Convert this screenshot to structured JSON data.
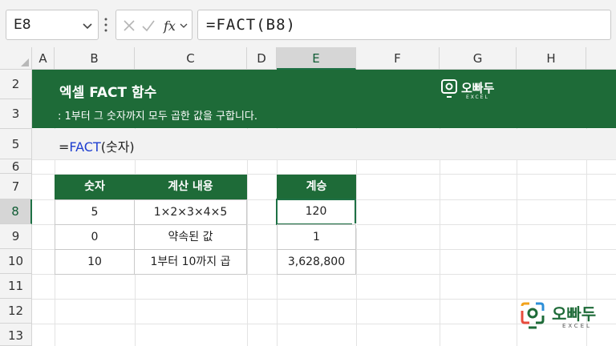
{
  "formula_bar": {
    "name_box": "E8",
    "formula": "=FACT(B8)",
    "icons": [
      "chevron-down-icon",
      "more-vertical-icon",
      "cancel-icon",
      "enter-icon",
      "fx-icon"
    ]
  },
  "columns": [
    "A",
    "B",
    "C",
    "D",
    "E",
    "F",
    "G",
    "H"
  ],
  "rows": [
    "2",
    "3",
    "5",
    "6",
    "7",
    "8",
    "9",
    "10",
    "11",
    "12",
    "13"
  ],
  "selected_column": "E",
  "selected_row": "8",
  "banner": {
    "title": "엑셀 FACT 함수",
    "subtitle": ": 1부터 그 숫자까지 모두 곱한 값을 구합니다.",
    "logo_text": "오빠두",
    "logo_sub": "EXCEL"
  },
  "syntax": {
    "prefix": "=",
    "func": "FACT",
    "args": "(숫자)"
  },
  "table1": {
    "headers": [
      "숫자",
      "계산 내용"
    ],
    "rows": [
      [
        "5",
        "1×2×3×4×5"
      ],
      [
        "0",
        "약속된 값"
      ],
      [
        "10",
        "1부터 10까지 곱"
      ]
    ]
  },
  "table2": {
    "header": "계승",
    "values": [
      "120",
      "1",
      "3,628,800"
    ]
  },
  "footer_logo": {
    "text": "오빠두",
    "sub": "EXCEL"
  },
  "colors": {
    "accent": "#1e6b38",
    "function_blue": "#1f3fd0"
  }
}
